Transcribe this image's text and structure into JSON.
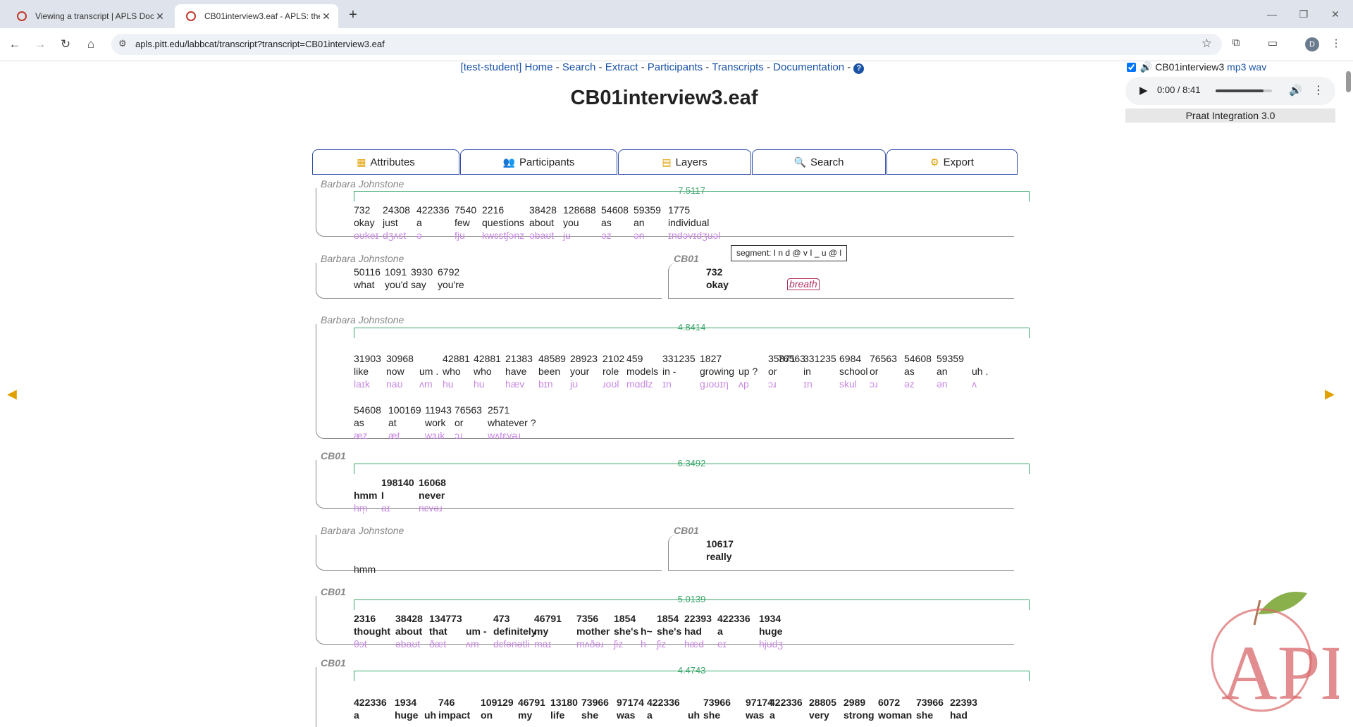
{
  "browser": {
    "tabs": [
      {
        "title": "Viewing a transcript | APLS Doc"
      },
      {
        "title": "CB01interview3.eaf - APLS: the"
      }
    ],
    "url": "apls.pitt.edu/labbcat/transcript?transcript=CB01interview3.eaf",
    "avatar": "D"
  },
  "nav": {
    "user": "[test-student]",
    "links": [
      "Home",
      "Search",
      "Extract",
      "Participants",
      "Transcripts",
      "Documentation"
    ],
    "help": "?"
  },
  "title": "CB01interview3.eaf",
  "tabs": [
    "Attributes",
    "Participants",
    "Layers",
    "Search",
    "Export"
  ],
  "speakers": {
    "a": "Barbara Johnstone",
    "b": "CB01"
  },
  "durations": [
    "7.5117",
    "4.8414",
    "6.3492",
    "5.0139",
    "4.4743"
  ],
  "tooltip": "segment: I n d @ v I _ u @ l",
  "breath": "breath",
  "media": {
    "name": "CB01interview3",
    "mp3": "mp3",
    "wav": "wav",
    "time": "0:00 / 8:41",
    "praat": "Praat Integration 3.0",
    "progress": 0.85
  },
  "words": {
    "t1": [
      [
        "732",
        "okay",
        "oʊkeɪ"
      ],
      [
        "24308",
        "just",
        "dʒʌst"
      ],
      [
        "422336",
        "a",
        "ə"
      ],
      [
        "7540",
        "few",
        "fju"
      ],
      [
        "2216",
        "questions",
        "kwɛstʃənz"
      ],
      [
        "38428",
        "about",
        "əbaʊt"
      ],
      [
        "128688",
        "you",
        "ju"
      ],
      [
        "54608",
        "as",
        "əz"
      ],
      [
        "59359",
        "an",
        "ən"
      ],
      [
        "1775",
        "individual",
        "ɪndəvɪdʒuəl"
      ]
    ],
    "t2": [
      [
        "50116",
        "what",
        ""
      ],
      [
        "1091",
        "you'd",
        ""
      ],
      [
        "3930",
        "say",
        ""
      ],
      [
        "6792",
        "you're",
        ""
      ]
    ],
    "t3": [
      [
        "732",
        "okay",
        ""
      ]
    ],
    "t4a": [
      [
        "31903",
        "like",
        "laɪk"
      ],
      [
        "30968",
        "now",
        "naʊ"
      ],
      [
        "",
        "um .",
        "ʌm"
      ],
      [
        "42881",
        "who",
        "hu"
      ],
      [
        "42881",
        "who",
        "hu"
      ],
      [
        "21383",
        "have",
        "hæv"
      ],
      [
        "48589",
        "been",
        "bɪn"
      ],
      [
        "28923",
        "your",
        "jʊ"
      ],
      [
        "2102",
        "role",
        "ɹoʊl"
      ],
      [
        "459",
        "models",
        "mɑdlz"
      ],
      [
        "331235",
        "in -",
        "ɪn"
      ],
      [
        "1827",
        "growing",
        "gɹoʊɪŋ"
      ],
      [
        "",
        "up ?",
        "ʌp"
      ],
      [
        "35871",
        "or",
        "ɔɹ"
      ],
      [
        "76563",
        "",
        ""
      ],
      [
        "331235",
        "in",
        "ɪn"
      ],
      [
        "6984",
        "school",
        "skul"
      ],
      [
        "76563",
        "or",
        "ɔɹ"
      ],
      [
        "54608",
        "as",
        "əz"
      ],
      [
        "59359",
        "an",
        "ən"
      ],
      [
        "",
        "uh .",
        "ʌ"
      ]
    ],
    "t4b": [
      [
        "54608",
        "as",
        "æz"
      ],
      [
        "100169",
        "at",
        "æt"
      ],
      [
        "11943",
        "work",
        "wɜɹk"
      ],
      [
        "76563",
        "or",
        "ɔɹ"
      ],
      [
        "2571",
        "whatever ?",
        "wʌtɛvəɹ"
      ]
    ],
    "t5": [
      [
        "",
        "hmm",
        "hm̩"
      ],
      [
        "198140",
        "I",
        "aɪ"
      ],
      [
        "16068",
        "never",
        "nɛvəɹ"
      ]
    ],
    "t6": [
      [
        "",
        "hmm",
        ""
      ]
    ],
    "t7": [
      [
        "10617",
        "really",
        ""
      ]
    ],
    "t8": [
      [
        "2316",
        "thought",
        "θɔt"
      ],
      [
        "38428",
        "about",
        "əbaʊt"
      ],
      [
        "134773",
        "that",
        "ðæt"
      ],
      [
        "",
        "um -",
        "ʌm"
      ],
      [
        "473",
        "definitely",
        "dɛfənətli"
      ],
      [
        "46791",
        "my",
        "maɪ"
      ],
      [
        "7356",
        "mother",
        "mʌðəɹ"
      ],
      [
        "1854",
        "she's",
        "ʃiz"
      ],
      [
        "",
        "h~",
        "h"
      ],
      [
        "1854",
        "she's",
        "ʃiz"
      ],
      [
        "22393",
        "had",
        "hæd"
      ],
      [
        "422336",
        "a",
        "eɪ"
      ],
      [
        "1934",
        "huge",
        "hjudʒ"
      ]
    ],
    "t9": [
      [
        "422336",
        "a",
        ""
      ],
      [
        "1934",
        "huge",
        ""
      ],
      [
        "",
        "uh",
        ""
      ],
      [
        "746",
        "impact",
        ""
      ],
      [
        "109129",
        "on",
        ""
      ],
      [
        "46791",
        "my",
        ""
      ],
      [
        "13180",
        "life",
        ""
      ],
      [
        "73966",
        "she",
        ""
      ],
      [
        "97174",
        "was",
        ""
      ],
      [
        "422336",
        "a",
        ""
      ],
      [
        "",
        "uh",
        ""
      ],
      [
        "73966",
        "she",
        ""
      ],
      [
        "97174",
        "was",
        ""
      ],
      [
        "422336",
        "a",
        ""
      ],
      [
        "28805",
        "very",
        ""
      ],
      [
        "2989",
        "strong",
        ""
      ],
      [
        "6072",
        "woman",
        ""
      ],
      [
        "73966",
        "she",
        ""
      ],
      [
        "22393",
        "had",
        ""
      ]
    ]
  }
}
